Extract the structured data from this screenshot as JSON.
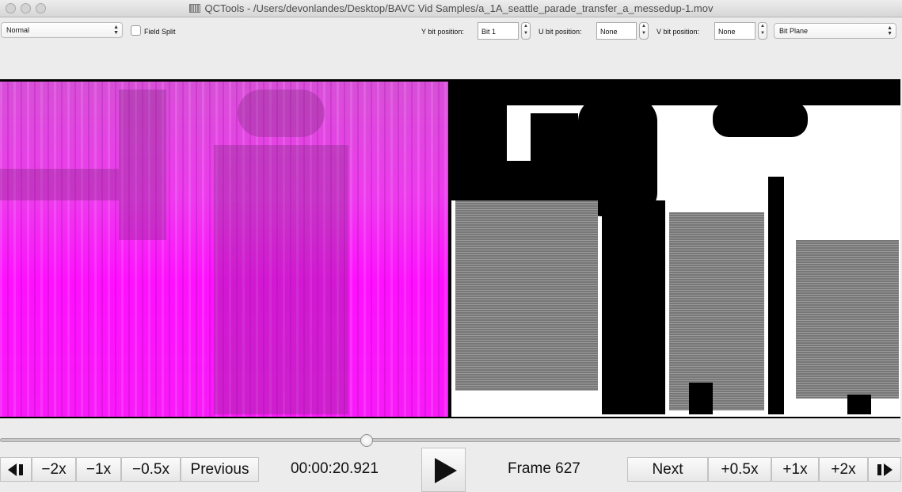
{
  "window": {
    "title": "QCTools - /Users/devonlandes/Desktop/BAVC Vid Samples/a_1A_seattle_parade_transfer_a_messedup-1.mov"
  },
  "toolbar": {
    "display_mode": "Normal",
    "field_split_label": "Field Split",
    "field_split_checked": false,
    "y_bit_label": "Y bit position:",
    "y_bit_value": "Bit 1",
    "u_bit_label": "U bit position:",
    "u_bit_value": "None",
    "v_bit_label": "V bit position:",
    "v_bit_value": "None",
    "filter_value": "Bit Plane"
  },
  "playback": {
    "rewind2x": "−2x",
    "rewind1x": "−1x",
    "rewind05x": "−0.5x",
    "previous": "Previous",
    "timecode": "00:00:20.921",
    "frame": "Frame 627",
    "next": "Next",
    "ff05x": "+0.5x",
    "ff1x": "+1x",
    "ff2x": "+2x",
    "position_fraction": 0.4
  },
  "icons": {
    "step_back": "step-back-icon",
    "play": "play-icon",
    "step_forward": "step-forward-icon"
  },
  "colors": {
    "left_pane_tint": "#ff10ff",
    "right_pane_bg": "#ffffff"
  }
}
